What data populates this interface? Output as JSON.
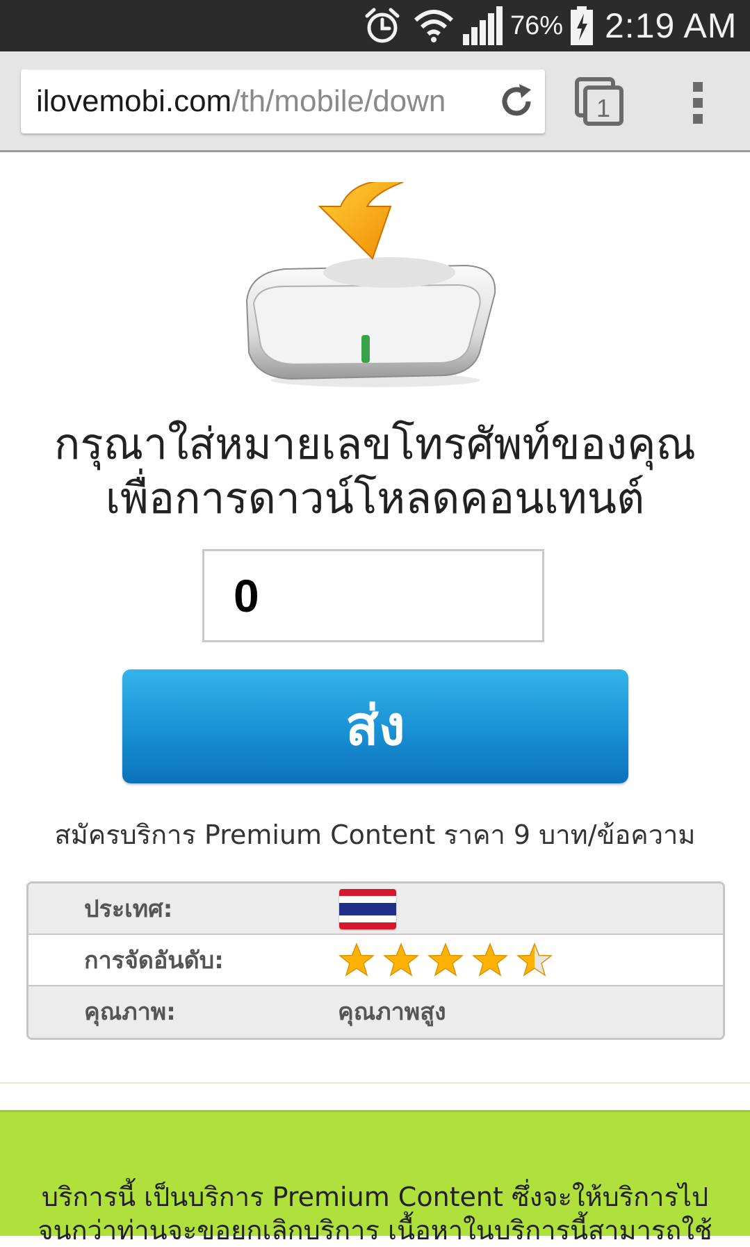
{
  "status_bar": {
    "battery_percent": "76%",
    "time": "2:19 AM",
    "icons": [
      "alarm-icon",
      "wifi-icon",
      "signal-icon",
      "battery-charging-icon"
    ]
  },
  "browser": {
    "url_host": "ilovemobi.com",
    "url_path": "/th/mobile/down",
    "tab_count": "1",
    "icons": [
      "reload-icon",
      "tabs-icon",
      "overflow-menu-icon"
    ]
  },
  "main": {
    "hero_icon": "download-drive-icon",
    "headline_line1": "กรุณาใส่หมายเลขโทรศัพท์ของคุณ",
    "headline_line2": "เพื่อการดาวน์โหลดคอนเทนต์",
    "phone_value": "0",
    "send_label": "ส่ง",
    "price_text": "สมัครบริการ Premium Content ราคา 9 บาท/ข้อความ"
  },
  "info_table": {
    "country_label": "ประเทศ:",
    "country_flag": "thailand-flag",
    "rating_label": "การจัดอันดับ:",
    "rating_value": 4.5,
    "rating_max": 5,
    "quality_label": "คุณภาพ:",
    "quality_value": "คุณภาพสูง"
  },
  "footer": {
    "line1": "บริการนี้ เป็นบริการ Premium Content ซึ่งจะให้บริการไป",
    "line2": "จนกว่าท่านจะขอยกเลิกบริการ เนื้อหาในบริการนี้สามารถใช้"
  },
  "colors": {
    "button_top": "#34b4ea",
    "button_bottom": "#0a72bc",
    "star": "#ffb300",
    "footer_band": "#b0e03c"
  }
}
